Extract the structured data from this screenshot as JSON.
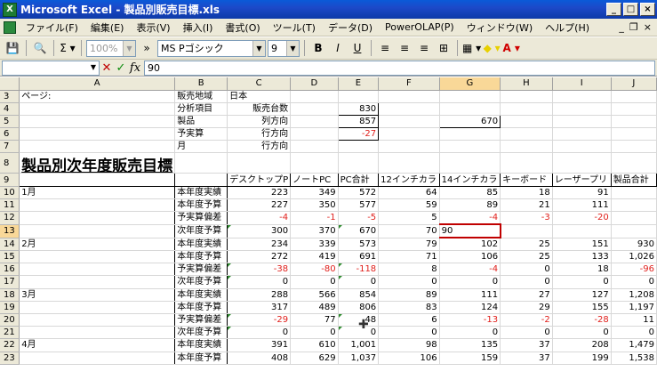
{
  "title": "Microsoft Excel - 製品別販売目標.xls",
  "window_buttons": [
    "_",
    "□",
    "×"
  ],
  "menu": [
    "ファイル(F)",
    "編集(E)",
    "表示(V)",
    "挿入(I)",
    "書式(O)",
    "ツール(T)",
    "データ(D)",
    "PowerOLAP(P)",
    "ウィンドウ(W)",
    "ヘルプ(H)"
  ],
  "doc_controls": [
    "_",
    "❐",
    "×"
  ],
  "toolbar": {
    "zoom": "100%",
    "font": "MS Pゴシック",
    "size": "9"
  },
  "formula_bar": {
    "name_box": "",
    "value": "90"
  },
  "columns": [
    "",
    "A",
    "B",
    "C",
    "D",
    "E",
    "F",
    "G",
    "H",
    "I",
    "J"
  ],
  "selected_column": "G",
  "rows": [
    {
      "n": "3",
      "cells": [
        "ページ:",
        "販売地域",
        "日本",
        "",
        "",
        "",
        "",
        "",
        "",
        ""
      ]
    },
    {
      "n": "4",
      "cells": [
        "",
        "分析項目",
        "販売台数",
        "",
        "830",
        "",
        "",
        "",
        "",
        ""
      ]
    },
    {
      "n": "5",
      "cells": [
        "",
        "製品",
        "列方向",
        "",
        "857",
        "",
        "670",
        "",
        "",
        ""
      ]
    },
    {
      "n": "6",
      "cells": [
        "",
        "予実算",
        "行方向",
        "",
        "-27",
        "",
        "",
        "",
        "",
        ""
      ]
    },
    {
      "n": "7",
      "cells": [
        "",
        "月",
        "行方向",
        "",
        "",
        "",
        "",
        "",
        "",
        ""
      ]
    },
    {
      "n": "8",
      "cells": [
        "製品別次年度販売目標",
        "",
        "",
        "",
        "",
        "",
        "",
        "",
        "",
        ""
      ]
    },
    {
      "n": "9",
      "cells": [
        "",
        "",
        "デスクトップP",
        "ノートPC",
        "PC合計",
        "12インチカラ",
        "14インチカラ",
        "キーボード",
        "レーザープリ",
        "製品合計"
      ]
    },
    {
      "n": "10",
      "cells": [
        "1月",
        "本年度実績",
        "223",
        "349",
        "572",
        "64",
        "85",
        "18",
        "91",
        ""
      ]
    },
    {
      "n": "11",
      "cells": [
        "",
        "本年度予算",
        "227",
        "350",
        "577",
        "59",
        "89",
        "21",
        "111",
        ""
      ]
    },
    {
      "n": "12",
      "cells": [
        "",
        "予実算偏差",
        "-4",
        "-1",
        "-5",
        "5",
        "-4",
        "-3",
        "-20",
        ""
      ]
    },
    {
      "n": "13",
      "cells": [
        "",
        "次年度予算",
        "300",
        "370",
        "670",
        "70",
        "90",
        "",
        "",
        ""
      ]
    },
    {
      "n": "14",
      "cells": [
        "2月",
        "本年度実績",
        "234",
        "339",
        "573",
        "79",
        "102",
        "25",
        "151",
        "930"
      ]
    },
    {
      "n": "15",
      "cells": [
        "",
        "本年度予算",
        "272",
        "419",
        "691",
        "71",
        "106",
        "25",
        "133",
        "1,026"
      ]
    },
    {
      "n": "16",
      "cells": [
        "",
        "予実算偏差",
        "-38",
        "-80",
        "-118",
        "8",
        "-4",
        "0",
        "18",
        "-96"
      ]
    },
    {
      "n": "17",
      "cells": [
        "",
        "次年度予算",
        "0",
        "0",
        "0",
        "0",
        "0",
        "0",
        "0",
        "0"
      ]
    },
    {
      "n": "18",
      "cells": [
        "3月",
        "本年度実績",
        "288",
        "566",
        "854",
        "89",
        "111",
        "27",
        "127",
        "1,208"
      ]
    },
    {
      "n": "19",
      "cells": [
        "",
        "本年度予算",
        "317",
        "489",
        "806",
        "83",
        "124",
        "29",
        "155",
        "1,197"
      ]
    },
    {
      "n": "20",
      "cells": [
        "",
        "予実算偏差",
        "-29",
        "77",
        "48",
        "6",
        "-13",
        "-2",
        "-28",
        "11"
      ]
    },
    {
      "n": "21",
      "cells": [
        "",
        "次年度予算",
        "0",
        "0",
        "0",
        "0",
        "0",
        "0",
        "0",
        "0"
      ]
    },
    {
      "n": "22",
      "cells": [
        "4月",
        "本年度実績",
        "391",
        "610",
        "1,001",
        "98",
        "135",
        "37",
        "208",
        "1,479"
      ]
    },
    {
      "n": "23",
      "cells": [
        "",
        "本年度予算",
        "408",
        "629",
        "1,037",
        "106",
        "159",
        "37",
        "199",
        "1,538"
      ]
    }
  ]
}
